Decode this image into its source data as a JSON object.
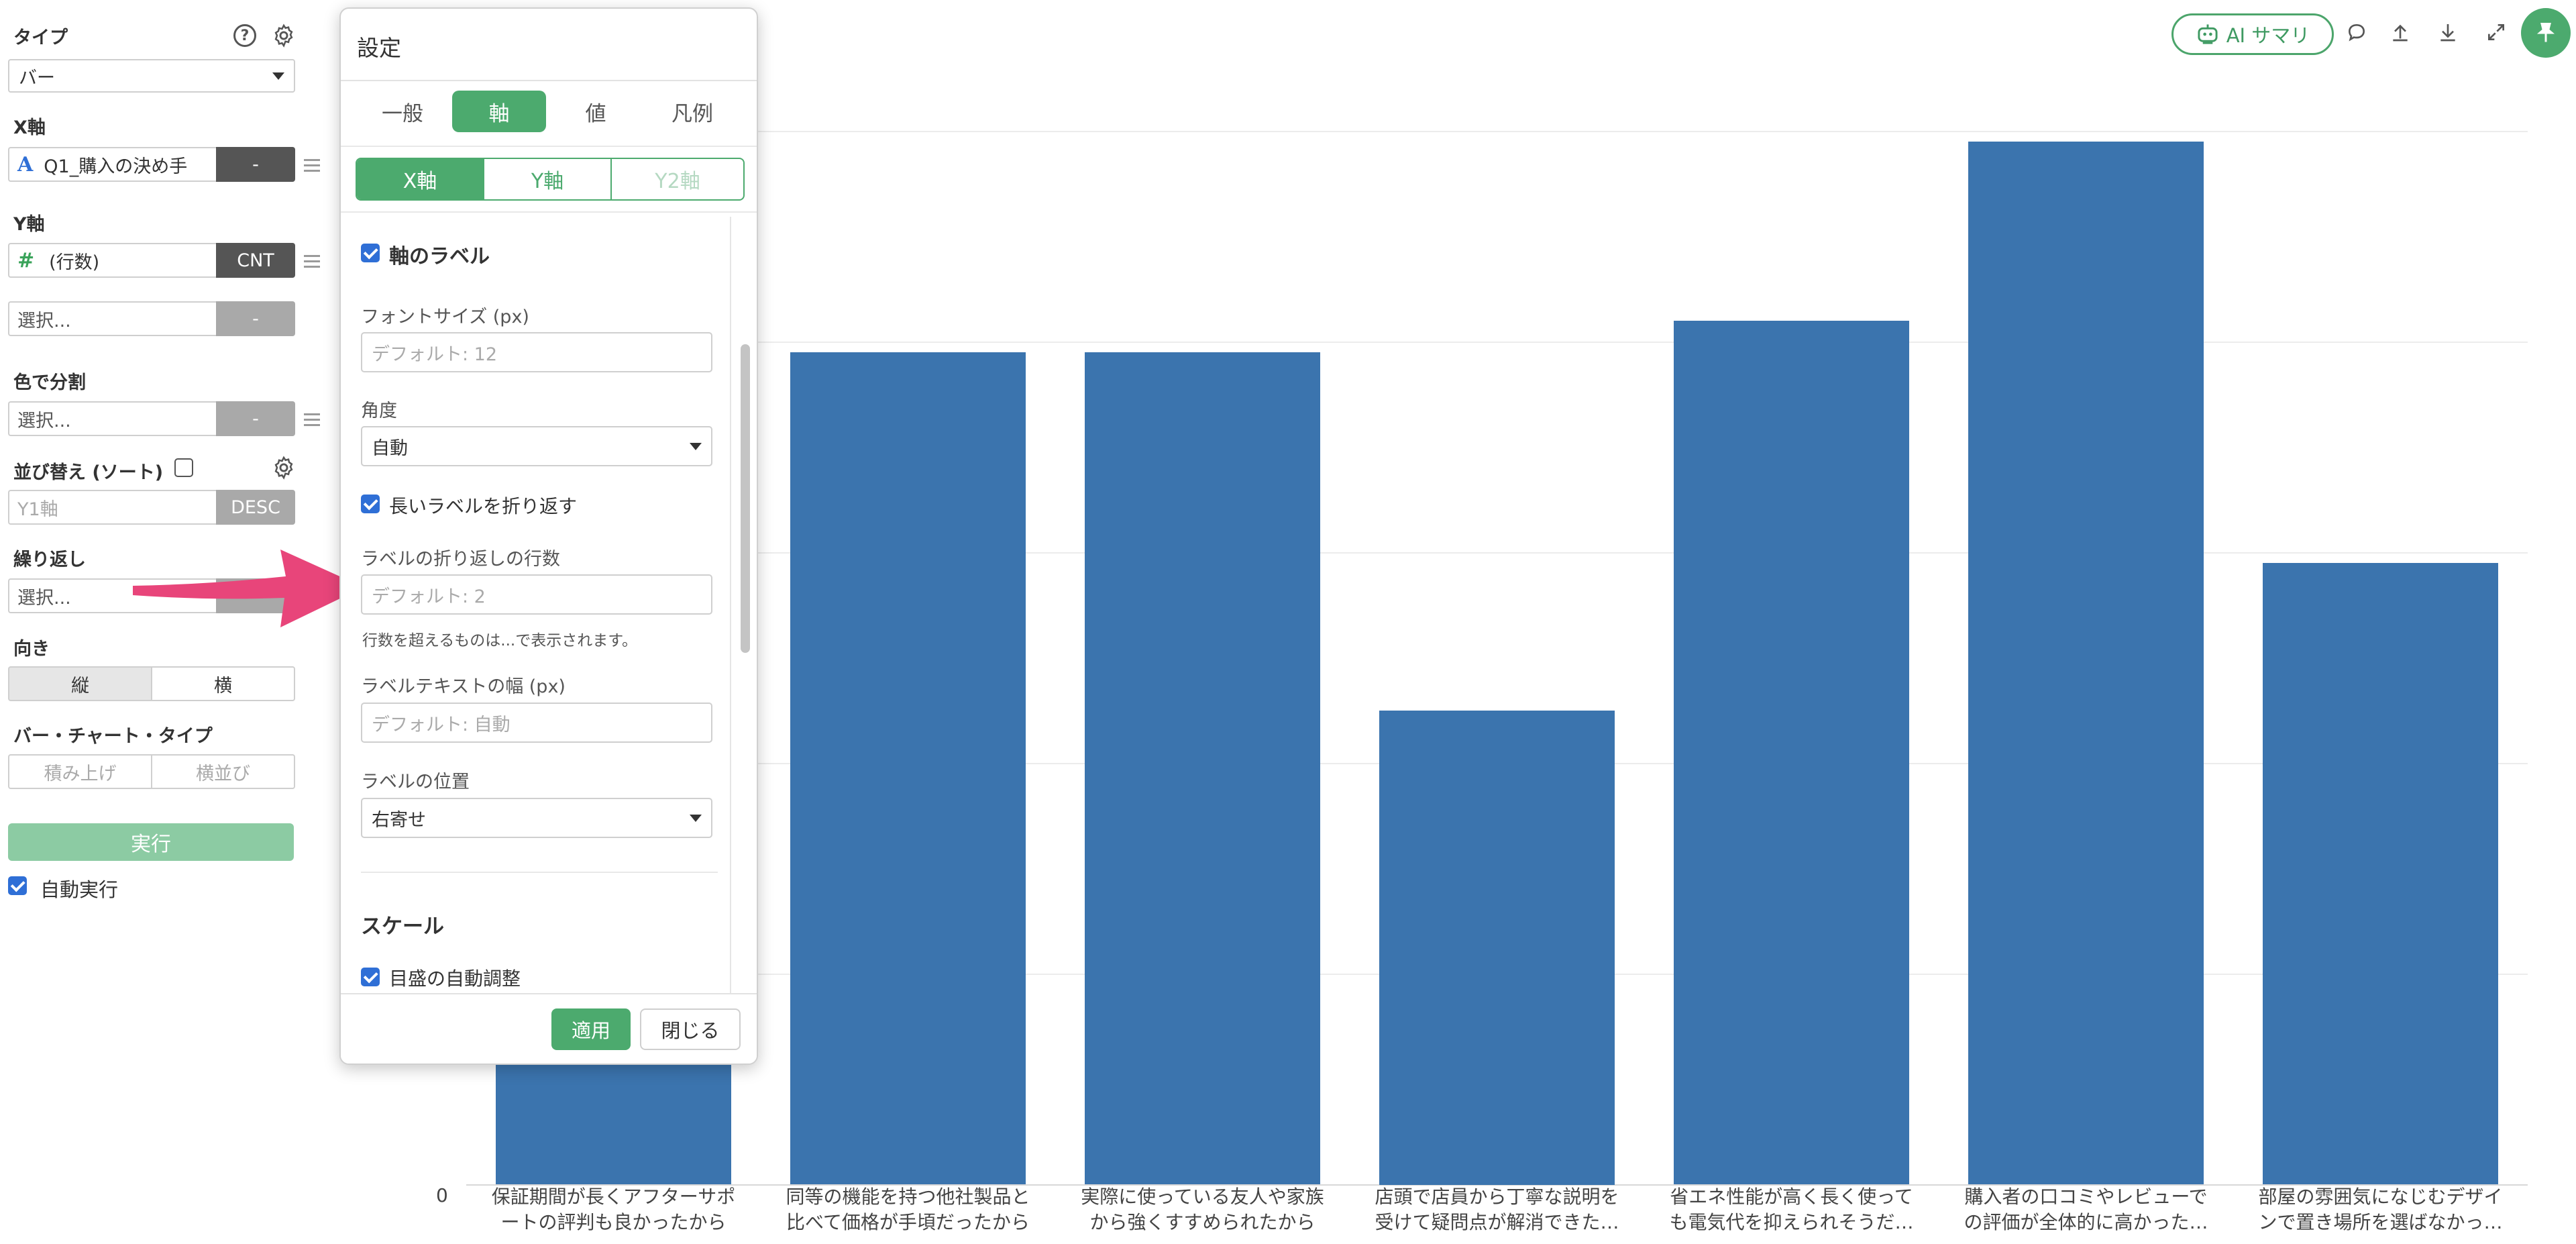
{
  "left_panel": {
    "type_label": "タイプ",
    "type_value": "バー",
    "x_axis_label": "X軸",
    "x_field": "Q1_購入の決め手",
    "x_field_type_icon": "A",
    "x_agg": "-",
    "y_axis_label": "Y軸",
    "y_field": "(行数)",
    "y_field_type_icon": "#",
    "y_agg": "CNT",
    "y2_field": "選択...",
    "y2_agg": "-",
    "color_label": "色で分割",
    "color_field": "選択...",
    "color_agg": "-",
    "sort_label": "並び替え (ソート)",
    "sort_field": "Y1軸",
    "sort_order": "DESC",
    "repeat_label": "繰り返し",
    "repeat_field": "選択...",
    "orientation_label": "向き",
    "orientation_options": [
      "縦",
      "横"
    ],
    "bar_type_label": "バー・チャート・タイプ",
    "bar_type_options": [
      "積み上げ",
      "横並び"
    ],
    "run_button": "実行",
    "auto_run_label": "自動実行"
  },
  "toolbar": {
    "ai_summary": "AI サマリ"
  },
  "dialog": {
    "title": "設定",
    "tabs": [
      "一般",
      "軸",
      "値",
      "凡例"
    ],
    "active_tab": "軸",
    "axis_tabs": [
      "X軸",
      "Y軸",
      "Y2軸"
    ],
    "axis_label_checkbox": "軸のラベル",
    "font_size_label": "フォントサイズ (px)",
    "font_size_placeholder": "デフォルト: 12",
    "angle_label": "角度",
    "angle_value": "自動",
    "wrap_checkbox": "長いラベルを折り返す",
    "wrap_lines_label": "ラベルの折り返しの行数",
    "wrap_lines_placeholder": "デフォルト: 2",
    "wrap_hint": "行数を超えるものは...で表示されます。",
    "text_width_label": "ラベルテキストの幅 (px)",
    "text_width_placeholder": "デフォルト: 自動",
    "position_label": "ラベルの位置",
    "position_value": "右寄せ",
    "scale_header": "スケール",
    "auto_tick_checkbox": "目盛の自動調整",
    "apply_button": "適用",
    "close_button": "閉じる"
  },
  "chart_data": {
    "type": "bar",
    "categories": [
      "保証期間が長くアフターサポートの評判も良かったから",
      "同等の機能を持つ他社製品と比べて価格が手頃だったから",
      "実際に使っている友人や家族から強くすすめられたから",
      "店頭で店員から丁寧な説明を受けて疑問点が解消できた…",
      "省エネ性能が高く長く使っても電気代を抑えられそうだ…",
      "購入者の口コミやレビューでの評価が全体的に高かった…",
      "部屋の雰囲気になじむデザインで置き場所を選ばなかっ…"
    ],
    "category_lines": [
      [
        "保証期間が長くアフターサポ",
        "ートの評判も良かったから"
      ],
      [
        "同等の機能を持つ他社製品と",
        "比べて価格が手頃だったから"
      ],
      [
        "実際に使っている友人や家族",
        "から強くすすめられたから"
      ],
      [
        "店頭で店員から丁寧な説明を",
        "受けて疑問点が解消できた…"
      ],
      [
        "省エネ性能が高く長く使って",
        "も電気代を抑えられそうだ…"
      ],
      [
        "購入者の口コミやレビューで",
        "の評価が全体的に高かった…"
      ],
      [
        "部屋の雰囲気になじむデザイ",
        "ンで置き場所を選ばなかっ…"
      ]
    ],
    "values": [
      28,
      39.5,
      39.5,
      22.5,
      41,
      49.5,
      29.5
    ],
    "ylim": [
      0,
      50
    ],
    "y_tick_labels": [
      "0"
    ],
    "grid": true,
    "bar_color": "#3b74ae"
  },
  "colors": {
    "accent_green": "#4caa6e",
    "bar_blue": "#3b74ae",
    "arrow_pink": "#e8457a"
  }
}
